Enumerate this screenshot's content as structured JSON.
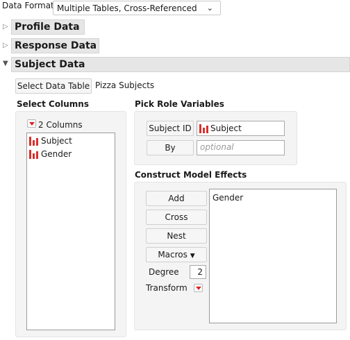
{
  "data_format": {
    "label": "Data Format",
    "value": "Multiple Tables, Cross-Referenced"
  },
  "sections": [
    {
      "title": "Profile Data",
      "expanded": false
    },
    {
      "title": "Response Data",
      "expanded": false
    },
    {
      "title": "Subject Data",
      "expanded": true
    }
  ],
  "subject": {
    "select_table_button": "Select Data Table",
    "table_name": "Pizza Subjects",
    "select_columns": {
      "heading": "Select Columns",
      "count_label": "2 Columns",
      "columns": [
        "Subject",
        "Gender"
      ]
    },
    "pick_role": {
      "heading": "Pick Role Variables",
      "subject_id_button": "Subject ID",
      "subject_id_value": "Subject",
      "by_button": "By",
      "by_placeholder": "optional"
    },
    "construct": {
      "heading": "Construct Model Effects",
      "add": "Add",
      "cross": "Cross",
      "nest": "Nest",
      "macros": "Macros",
      "degree_label": "Degree",
      "degree_value": "2",
      "transform_label": "Transform",
      "effects": [
        "Gender"
      ]
    }
  },
  "colors": {
    "accent_red": "#d9302c",
    "section_bg": "#e6e6e6",
    "panel_bg": "#f4f4f4"
  }
}
